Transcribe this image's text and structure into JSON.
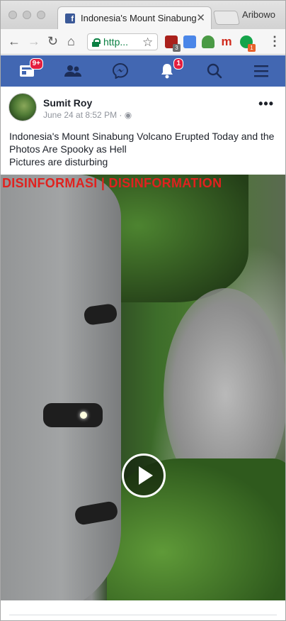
{
  "browser": {
    "tab_title": "Indonesia's Mount Sinabung",
    "tab_close": "✕",
    "profile_name": "Aribowo",
    "url": "http...",
    "extensions": [
      {
        "name": "ublock",
        "color": "#a9201b",
        "badge": "3"
      },
      {
        "name": "translate",
        "color": "#4a86e8",
        "badge": ""
      },
      {
        "name": "download",
        "color": "#4a9a45",
        "badge": ""
      },
      {
        "name": "mendeley",
        "color": "#d02b1d",
        "badge": ""
      },
      {
        "name": "grammarly",
        "color": "#15a44a",
        "badge": "1"
      }
    ],
    "menu_icon": "⋮"
  },
  "facebook_nav": {
    "home_badge": "9+",
    "notifications_badge": "1",
    "brand_color": "#4267b2"
  },
  "post": {
    "author": "Sumit Roy",
    "timestamp": "June 24 at 8:52 PM",
    "separator": "·",
    "text_line1": "Indonesia's Mount Sinabung Volcano Erupted Today and the Photos Are Spooky as Hell",
    "text_line2": "Pictures are disturbing",
    "more_label": "•••",
    "video_stamp": "DISINFORMASI | DISINFORMATION"
  }
}
